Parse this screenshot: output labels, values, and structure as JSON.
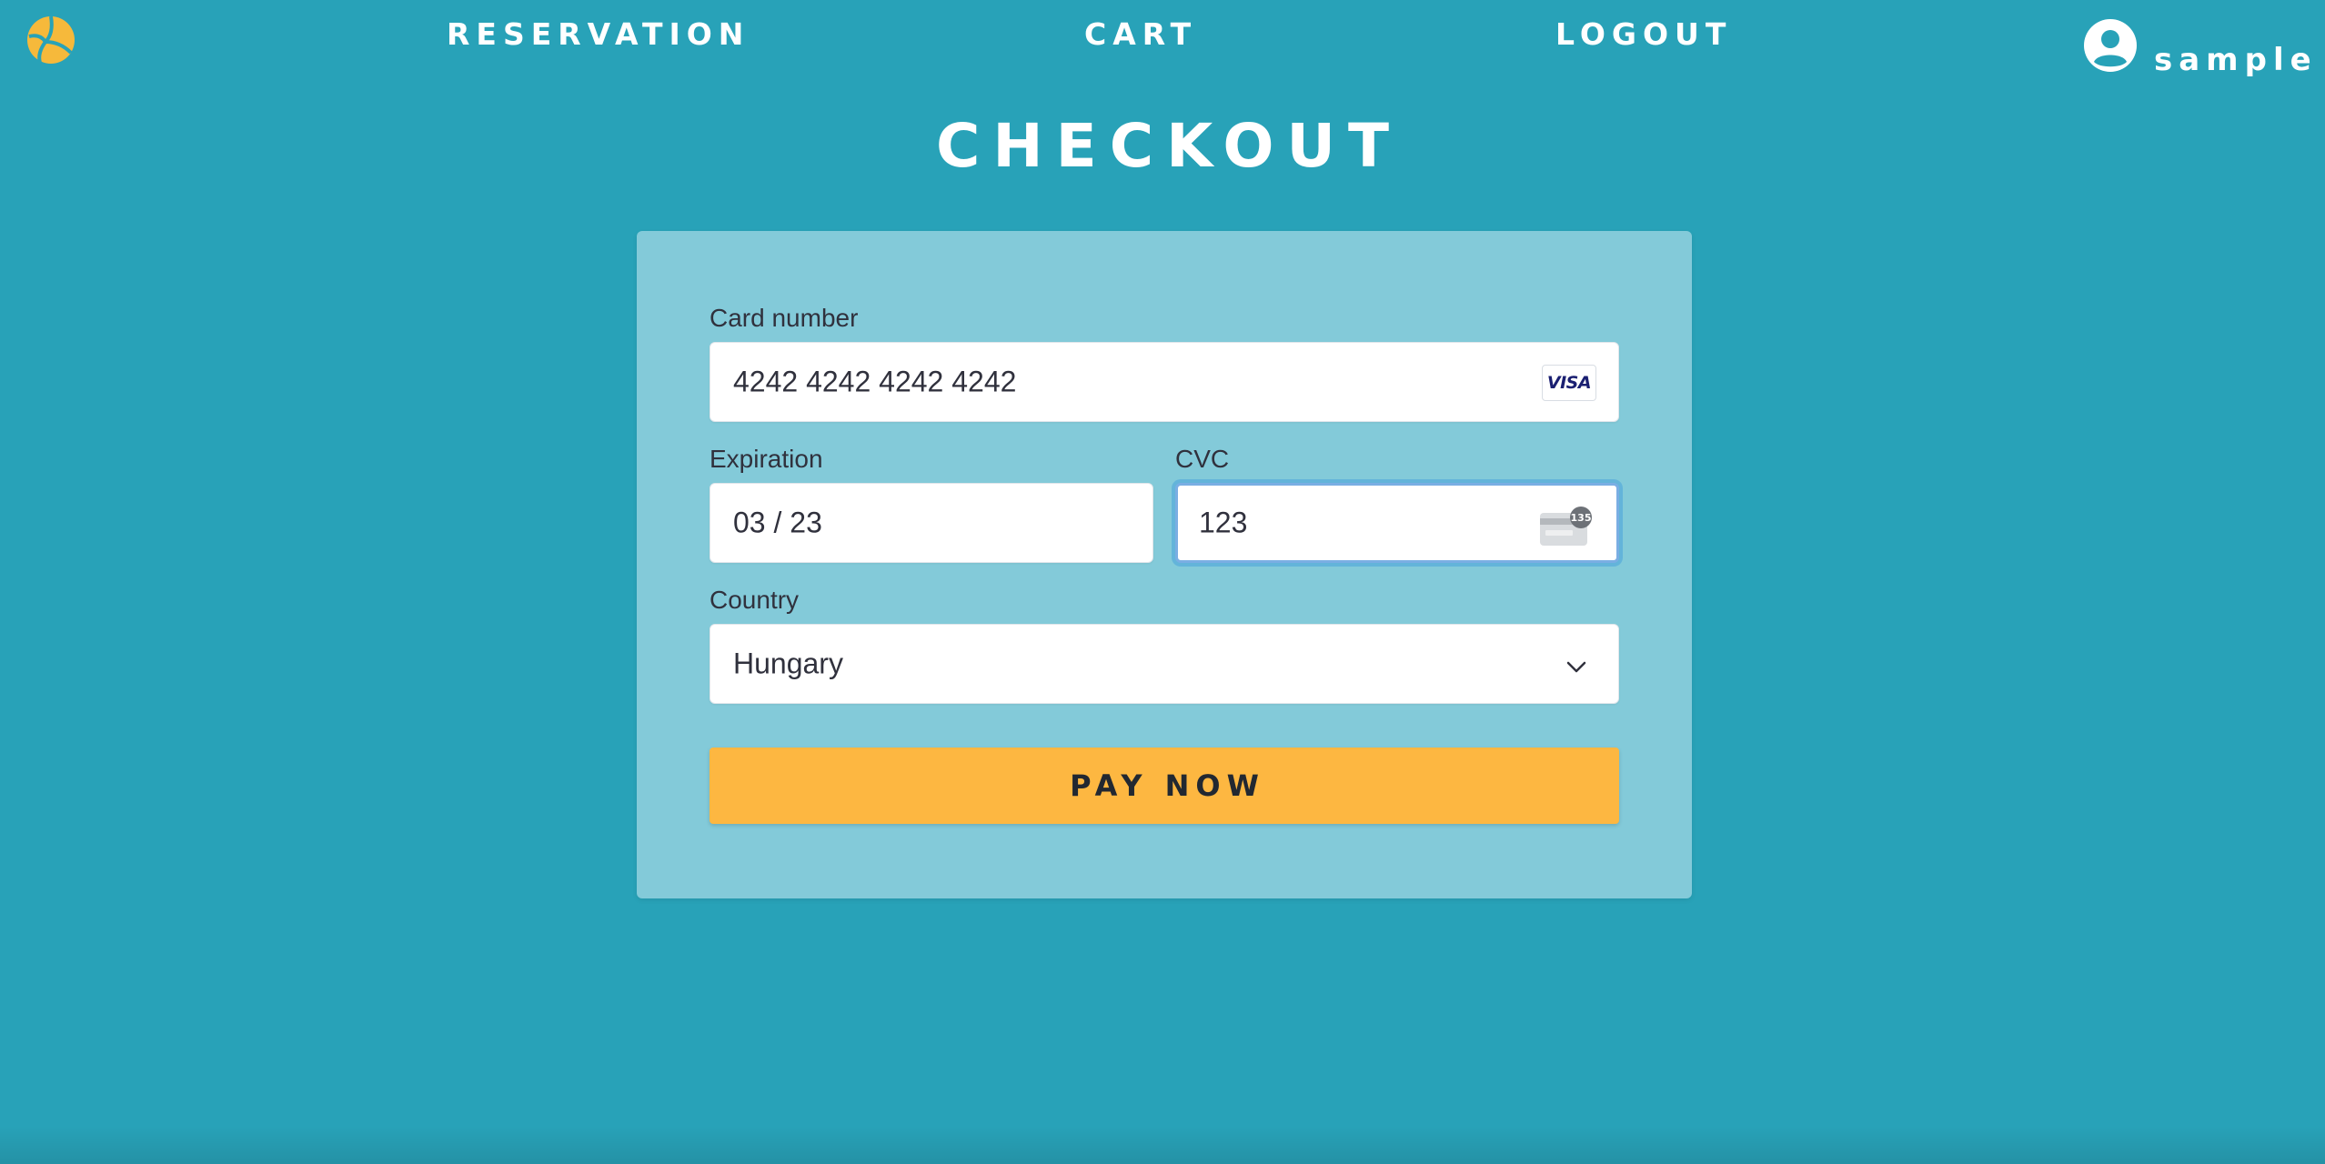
{
  "nav": {
    "links": [
      {
        "label": "RESERVATION"
      },
      {
        "label": "CART"
      },
      {
        "label": "LOGOUT"
      }
    ],
    "username": "sample"
  },
  "page": {
    "title": "CHECKOUT"
  },
  "form": {
    "card_number": {
      "label": "Card number",
      "value": "4242 4242 4242 4242",
      "brand": "VISA"
    },
    "expiration": {
      "label": "Expiration",
      "value": "03 / 23"
    },
    "cvc": {
      "label": "CVC",
      "value": "123",
      "icon_badge": "135"
    },
    "country": {
      "label": "Country",
      "value": "Hungary"
    },
    "pay_button": "PAY NOW"
  },
  "colors": {
    "background": "#28a2b8",
    "card": "#83cad9",
    "accent": "#fdb741",
    "logo": "#f6b93b"
  },
  "icons": {
    "logo": "volleyball-icon",
    "user": "user-circle-icon",
    "card_brand": "visa-icon",
    "cvc": "cvc-card-icon",
    "dropdown": "chevron-down-icon"
  }
}
